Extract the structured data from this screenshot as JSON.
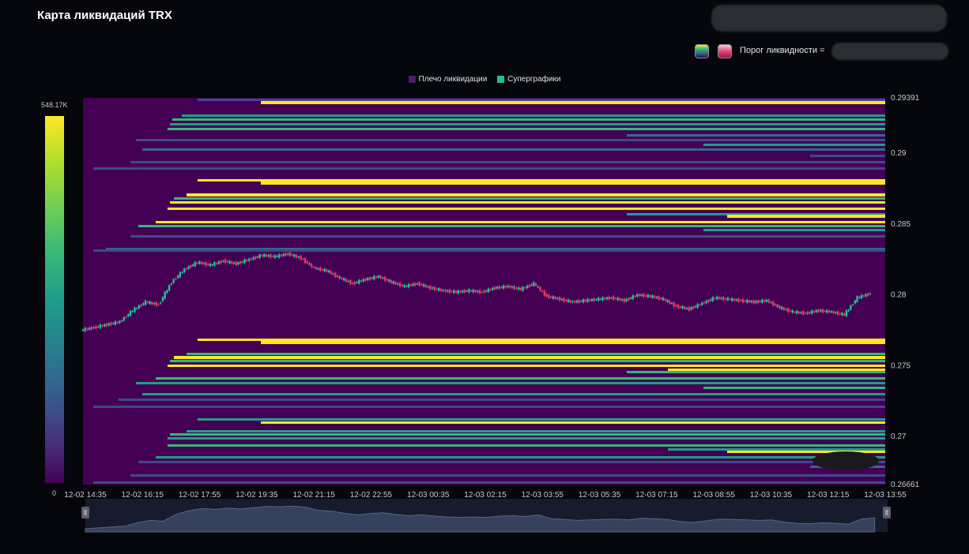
{
  "header": {
    "title": "Карта ликвидаций TRX",
    "threshold_label": "Порог ликвидности ="
  },
  "legend": {
    "items": [
      {
        "label": "Плечо ликвидации",
        "color": "#4b1f6b"
      },
      {
        "label": "Суперграфики",
        "color": "#22c38a"
      }
    ]
  },
  "colorbar": {
    "max_label": "548.17K",
    "min_label": "0"
  },
  "colors": {
    "background": "#05070c",
    "plot_background": "#440154",
    "up_candle": "#21c39b",
    "down_candle": "#ea3a63"
  },
  "chart_data": {
    "type": "heatmap",
    "title": "Карта ликвидаций TRX",
    "x_ticks": [
      "12-02 14:35",
      "12-02 16:15",
      "12-02 17:55",
      "12-02 19:35",
      "12-02 21:15",
      "12-02 22:55",
      "12-03 00:35",
      "12-03 02:15",
      "12-03 03:55",
      "12-03 05:35",
      "12-03 07:15",
      "12-03 08:55",
      "12-03 10:35",
      "12-03 12:15",
      "12-03 13:55"
    ],
    "y_ticks": [
      0.29391,
      0.29,
      0.285,
      0.28,
      0.275,
      0.27,
      0.26661
    ],
    "y_tick_labels": [
      "0.29391",
      "0.29",
      "0.285",
      "0.28",
      "0.275",
      "0.27",
      "0.26661"
    ],
    "ylim": [
      0.26661,
      0.29391
    ],
    "colorbar_range": [
      0,
      548170
    ],
    "price_series": [
      {
        "t": 0.0,
        "p": 0.2775
      },
      {
        "t": 0.5,
        "p": 0.2777
      },
      {
        "t": 1.0,
        "p": 0.2779
      },
      {
        "t": 1.5,
        "p": 0.2781
      },
      {
        "t": 2.0,
        "p": 0.2789
      },
      {
        "t": 2.5,
        "p": 0.2795
      },
      {
        "t": 3.0,
        "p": 0.2793
      },
      {
        "t": 3.5,
        "p": 0.2809
      },
      {
        "t": 4.0,
        "p": 0.2818
      },
      {
        "t": 4.5,
        "p": 0.2823
      },
      {
        "t": 5.0,
        "p": 0.2821
      },
      {
        "t": 5.5,
        "p": 0.2824
      },
      {
        "t": 6.0,
        "p": 0.2822
      },
      {
        "t": 6.5,
        "p": 0.2825
      },
      {
        "t": 7.0,
        "p": 0.2828
      },
      {
        "t": 7.5,
        "p": 0.2827
      },
      {
        "t": 8.0,
        "p": 0.2829
      },
      {
        "t": 8.5,
        "p": 0.2826
      },
      {
        "t": 9.0,
        "p": 0.2819
      },
      {
        "t": 9.5,
        "p": 0.2817
      },
      {
        "t": 10.0,
        "p": 0.2812
      },
      {
        "t": 10.5,
        "p": 0.2808
      },
      {
        "t": 11.0,
        "p": 0.2811
      },
      {
        "t": 11.5,
        "p": 0.2813
      },
      {
        "t": 12.0,
        "p": 0.2809
      },
      {
        "t": 12.5,
        "p": 0.2806
      },
      {
        "t": 13.0,
        "p": 0.2808
      },
      {
        "t": 13.5,
        "p": 0.2805
      },
      {
        "t": 14.0,
        "p": 0.2803
      },
      {
        "t": 14.5,
        "p": 0.2802
      },
      {
        "t": 15.0,
        "p": 0.2803
      },
      {
        "t": 15.5,
        "p": 0.2802
      },
      {
        "t": 16.0,
        "p": 0.2805
      },
      {
        "t": 16.5,
        "p": 0.2806
      },
      {
        "t": 17.0,
        "p": 0.2804
      },
      {
        "t": 17.5,
        "p": 0.2808
      },
      {
        "t": 18.0,
        "p": 0.2799
      },
      {
        "t": 18.5,
        "p": 0.2797
      },
      {
        "t": 19.0,
        "p": 0.2795
      },
      {
        "t": 19.5,
        "p": 0.2796
      },
      {
        "t": 20.0,
        "p": 0.2797
      },
      {
        "t": 20.5,
        "p": 0.2798
      },
      {
        "t": 21.0,
        "p": 0.2796
      },
      {
        "t": 21.5,
        "p": 0.28
      },
      {
        "t": 22.0,
        "p": 0.2799
      },
      {
        "t": 22.5,
        "p": 0.2797
      },
      {
        "t": 23.0,
        "p": 0.2792
      },
      {
        "t": 23.5,
        "p": 0.279
      },
      {
        "t": 24.0,
        "p": 0.2794
      },
      {
        "t": 24.5,
        "p": 0.2798
      },
      {
        "t": 25.0,
        "p": 0.2797
      },
      {
        "t": 25.5,
        "p": 0.2796
      },
      {
        "t": 26.0,
        "p": 0.2795
      },
      {
        "t": 26.5,
        "p": 0.2796
      },
      {
        "t": 27.0,
        "p": 0.2791
      },
      {
        "t": 27.5,
        "p": 0.2788
      },
      {
        "t": 28.0,
        "p": 0.2787
      },
      {
        "t": 28.5,
        "p": 0.2789
      },
      {
        "t": 29.0,
        "p": 0.2788
      },
      {
        "t": 29.5,
        "p": 0.2786
      },
      {
        "t": 30.0,
        "p": 0.2798
      },
      {
        "t": 30.5,
        "p": 0.2801
      }
    ]
  }
}
